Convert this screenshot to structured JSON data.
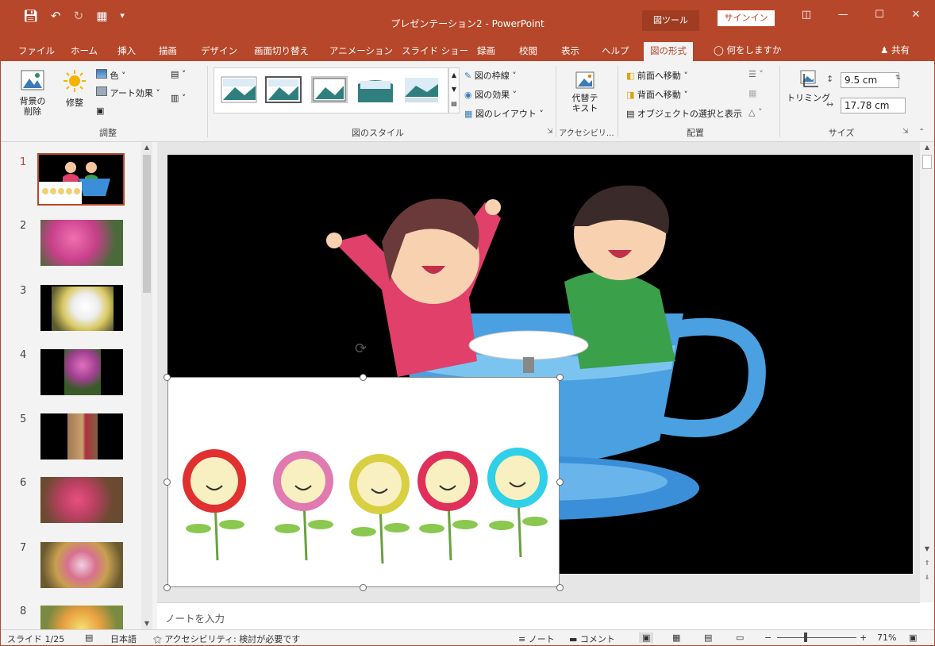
{
  "window": {
    "title": "プレゼンテーション2 - PowerPoint",
    "context_tab": "図ツール",
    "signin": "サインイン",
    "controls": [
      "ribbon-display-icon",
      "minimize-icon",
      "maximize-icon",
      "close-icon"
    ]
  },
  "qat": [
    "save-icon",
    "undo-icon",
    "redo-icon",
    "start-slideshow-icon",
    "customize-icon"
  ],
  "tabs": [
    {
      "label": "ファイル"
    },
    {
      "label": "ホーム"
    },
    {
      "label": "挿入"
    },
    {
      "label": "描画"
    },
    {
      "label": "デザイン"
    },
    {
      "label": "画面切り替え"
    },
    {
      "label": "アニメーション"
    },
    {
      "label": "スライド ショー"
    },
    {
      "label": "録画"
    },
    {
      "label": "校閲"
    },
    {
      "label": "表示"
    },
    {
      "label": "ヘルプ"
    },
    {
      "label": "図の形式"
    }
  ],
  "active_tab": "図の形式",
  "tellme": "何をしますか",
  "share": "共有",
  "ribbon": {
    "adjust": {
      "remove_bg": "背景の削除",
      "corrections": "修整",
      "color": "色",
      "artistic": "アート効果",
      "group_label": "調整"
    },
    "styles": {
      "border": "図の枠線",
      "effects": "図の効果",
      "layout": "図のレイアウト",
      "group_label": "図のスタイル"
    },
    "accessibility": {
      "alt_text": "代替テキスト",
      "group_label": "アクセシビリ…"
    },
    "arrange": {
      "bring_forward": "前面へ移動",
      "send_backward": "背面へ移動",
      "selection_pane": "オブジェクトの選択と表示",
      "group_label": "配置"
    },
    "size": {
      "crop": "トリミング",
      "height": "9.5 cm",
      "width": "17.78 cm",
      "group_label": "サイズ"
    }
  },
  "slides": [
    {
      "num": "1"
    },
    {
      "num": "2"
    },
    {
      "num": "3"
    },
    {
      "num": "4"
    },
    {
      "num": "5"
    },
    {
      "num": "6"
    },
    {
      "num": "7"
    },
    {
      "num": "8"
    }
  ],
  "selected_slide": "1",
  "notes_placeholder": "ノートを入力",
  "status": {
    "slide": "スライド 1/25",
    "language": "日本語",
    "accessibility": "アクセシビリティ: 検討が必要です",
    "notes": "ノート",
    "comments": "コメント",
    "zoom": "71%"
  },
  "colors": {
    "accent": "#b7472a",
    "ribbon": "#f3f3f3",
    "canvas": "#e6e6e6"
  }
}
